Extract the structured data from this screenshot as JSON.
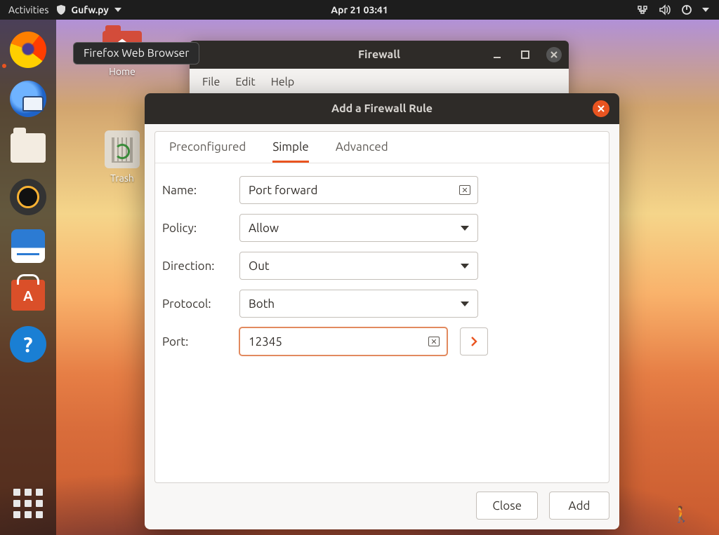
{
  "topbar": {
    "activities": "Activities",
    "appname": "Gufw.py",
    "datetime": "Apr 21  03:41"
  },
  "tooltip": "Firefox Web Browser",
  "desktop": {
    "home": "Home",
    "trash": "Trash"
  },
  "firewall_window": {
    "title": "Firewall",
    "menus": {
      "file": "File",
      "edit": "Edit",
      "help": "Help"
    }
  },
  "dialog": {
    "title": "Add a Firewall Rule",
    "tabs": {
      "preconfigured": "Preconfigured",
      "simple": "Simple",
      "advanced": "Advanced"
    },
    "labels": {
      "name": "Name:",
      "policy": "Policy:",
      "direction": "Direction:",
      "protocol": "Protocol:",
      "port": "Port:"
    },
    "values": {
      "name": "Port forward",
      "policy": "Allow",
      "direction": "Out",
      "protocol": "Both",
      "port": "12345"
    },
    "buttons": {
      "close": "Close",
      "add": "Add"
    }
  }
}
